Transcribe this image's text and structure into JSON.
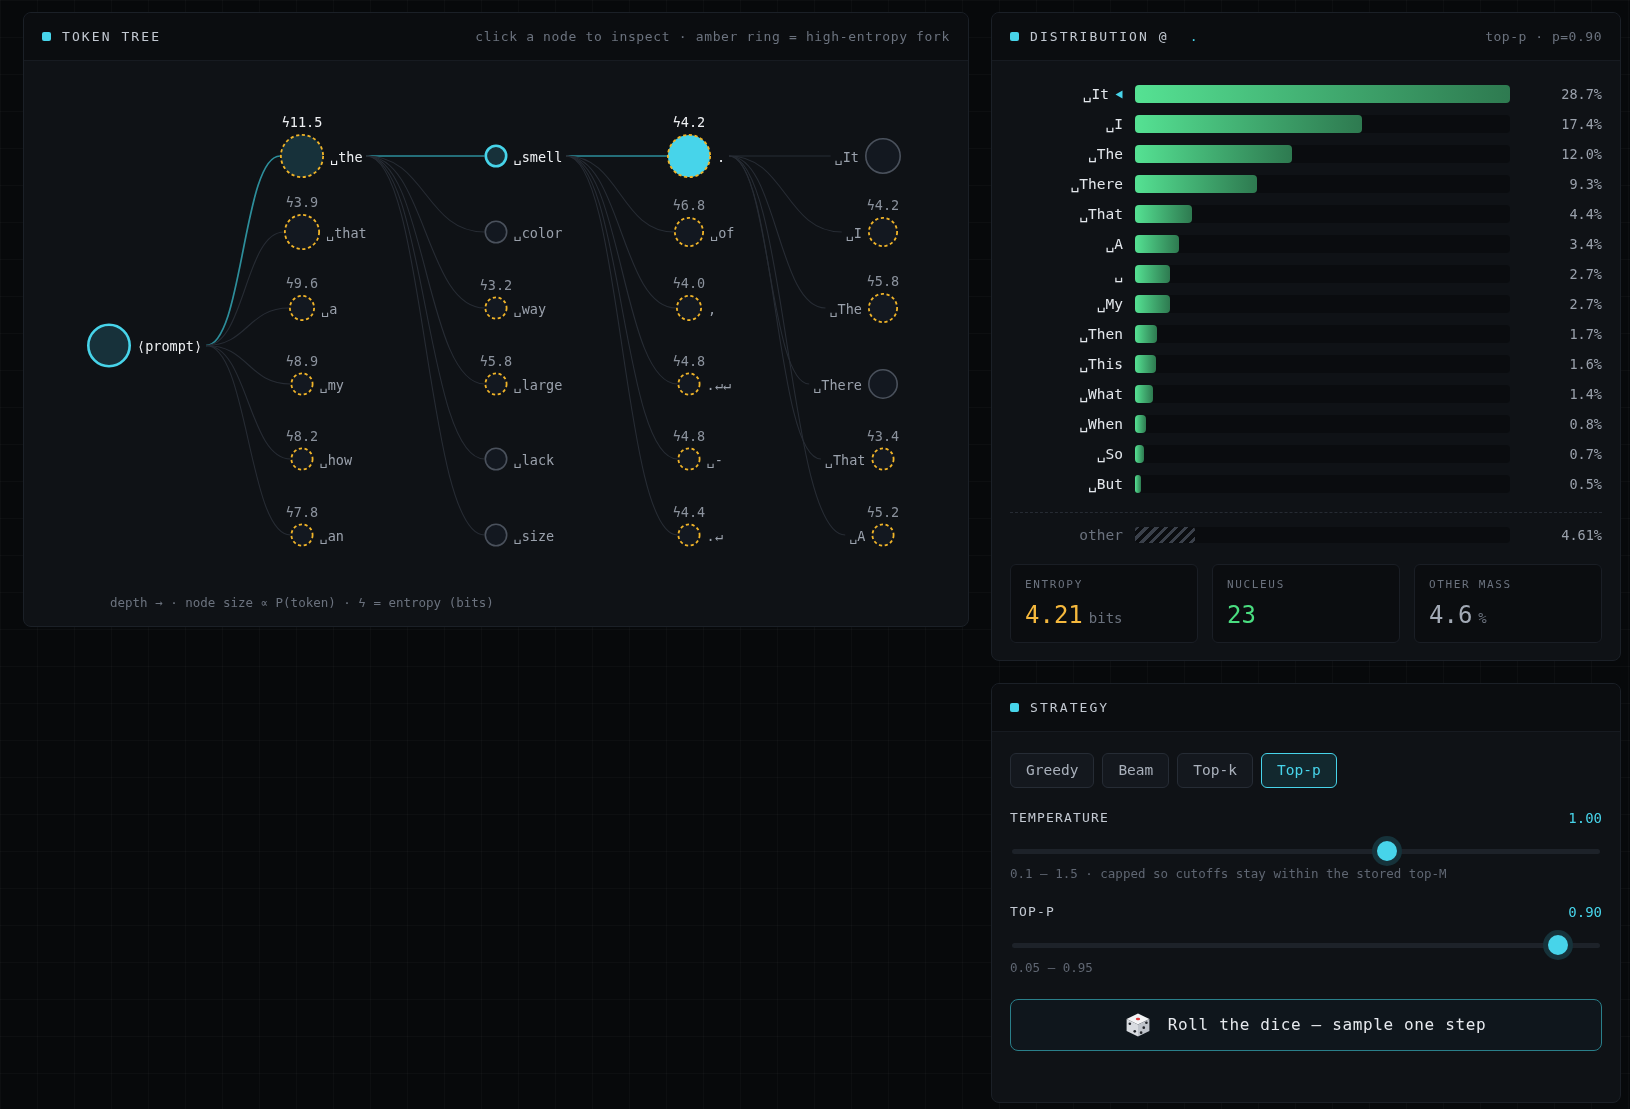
{
  "token_tree": {
    "title": "TOKEN TREE",
    "hint": "click a node to inspect · amber ring = high-entropy fork",
    "root": {
      "token": "⟨prompt⟩",
      "kind": "huge",
      "on_path": true,
      "selected": false,
      "high_entropy": false,
      "children": [
        {
          "token": "␣the",
          "entropy": "ϟ11.5",
          "kind": "huge",
          "on_path": true,
          "selected": false,
          "high_entropy": true,
          "children": [
            {
              "token": "␣smell",
              "kind": "tiny",
              "on_path": true,
              "selected": false,
              "high_entropy": false,
              "children": [
                {
                  "token": ".",
                  "entropy": "ϟ4.2",
                  "kind": "huge",
                  "on_path": true,
                  "selected": true,
                  "high_entropy": true,
                  "children": [
                    {
                      "token": "␣It",
                      "kind": "large",
                      "on_path": false,
                      "selected": false,
                      "high_entropy": false
                    },
                    {
                      "token": "␣I",
                      "entropy": "ϟ4.2",
                      "kind": "medium",
                      "on_path": false,
                      "selected": false,
                      "high_entropy": true
                    },
                    {
                      "token": "␣The",
                      "entropy": "ϟ5.8",
                      "kind": "medium",
                      "on_path": false,
                      "selected": false,
                      "high_entropy": true
                    },
                    {
                      "token": "␣There",
                      "kind": "medium",
                      "on_path": false,
                      "selected": false,
                      "high_entropy": false
                    },
                    {
                      "token": "␣That",
                      "entropy": "ϟ3.4",
                      "kind": "tiny",
                      "on_path": false,
                      "selected": false,
                      "high_entropy": true
                    },
                    {
                      "token": "␣A",
                      "entropy": "ϟ5.2",
                      "kind": "tiny",
                      "on_path": false,
                      "selected": false,
                      "high_entropy": true
                    }
                  ]
                },
                {
                  "token": "␣of",
                  "entropy": "ϟ6.8",
                  "kind": "medium",
                  "on_path": false,
                  "selected": false,
                  "high_entropy": true
                },
                {
                  "token": ",",
                  "entropy": "ϟ4.0",
                  "kind": "small",
                  "on_path": false,
                  "selected": false,
                  "high_entropy": true
                },
                {
                  "token": ".↵↵",
                  "entropy": "ϟ4.8",
                  "kind": "tiny",
                  "on_path": false,
                  "selected": false,
                  "high_entropy": true
                },
                {
                  "token": "␣-",
                  "entropy": "ϟ4.8",
                  "kind": "tiny",
                  "on_path": false,
                  "selected": false,
                  "high_entropy": true
                },
                {
                  "token": ".↵",
                  "entropy": "ϟ4.4",
                  "kind": "tiny",
                  "on_path": false,
                  "selected": false,
                  "high_entropy": true
                }
              ]
            },
            {
              "token": "␣color",
              "kind": "tiny",
              "on_path": false,
              "selected": false,
              "high_entropy": false
            },
            {
              "token": "␣way",
              "entropy": "ϟ3.2",
              "kind": "tiny",
              "on_path": false,
              "selected": false,
              "high_entropy": true
            },
            {
              "token": "␣large",
              "entropy": "ϟ5.8",
              "kind": "tiny",
              "on_path": false,
              "selected": false,
              "high_entropy": true
            },
            {
              "token": "␣lack",
              "kind": "tiny",
              "on_path": false,
              "selected": false,
              "high_entropy": false
            },
            {
              "token": "␣size",
              "kind": "tiny",
              "on_path": false,
              "selected": false,
              "high_entropy": false
            }
          ]
        },
        {
          "token": "␣that",
          "entropy": "ϟ3.9",
          "kind": "large",
          "on_path": false,
          "selected": false,
          "high_entropy": true
        },
        {
          "token": "␣a",
          "entropy": "ϟ9.6",
          "kind": "small",
          "on_path": false,
          "selected": false,
          "high_entropy": true
        },
        {
          "token": "␣my",
          "entropy": "ϟ8.9",
          "kind": "tiny",
          "on_path": false,
          "selected": false,
          "high_entropy": true
        },
        {
          "token": "␣how",
          "entropy": "ϟ8.2",
          "kind": "tiny",
          "on_path": false,
          "selected": false,
          "high_entropy": true
        },
        {
          "token": "␣an",
          "entropy": "ϟ7.8",
          "kind": "tiny",
          "on_path": false,
          "selected": false,
          "high_entropy": true
        }
      ]
    },
    "legend": "depth → · node size ∝ P(token) · ϟ = entropy (bits)"
  },
  "distribution": {
    "title": "DISTRIBUTION @",
    "token": ".",
    "mode": "top-p · p=0.90",
    "rows": [
      {
        "token": "␣It",
        "selected": true,
        "level": 1.0,
        "percent": "28.7%"
      },
      {
        "token": "␣I",
        "selected": false,
        "level": 0.606,
        "percent": "17.4%"
      },
      {
        "token": "␣The",
        "selected": false,
        "level": 0.418,
        "percent": "12.0%"
      },
      {
        "token": "␣There",
        "selected": false,
        "level": 0.324,
        "percent": "9.3%"
      },
      {
        "token": "␣That",
        "selected": false,
        "level": 0.153,
        "percent": "4.4%"
      },
      {
        "token": "␣A",
        "selected": false,
        "level": 0.118,
        "percent": "3.4%"
      },
      {
        "token": "␣",
        "selected": false,
        "level": 0.094,
        "percent": "2.7%"
      },
      {
        "token": "␣My",
        "selected": false,
        "level": 0.094,
        "percent": "2.7%"
      },
      {
        "token": "␣Then",
        "selected": false,
        "level": 0.059,
        "percent": "1.7%"
      },
      {
        "token": "␣This",
        "selected": false,
        "level": 0.056,
        "percent": "1.6%"
      },
      {
        "token": "␣What",
        "selected": false,
        "level": 0.049,
        "percent": "1.4%"
      },
      {
        "token": "␣When",
        "selected": false,
        "level": 0.028,
        "percent": "0.8%"
      },
      {
        "token": "␣So",
        "selected": false,
        "level": 0.024,
        "percent": "0.7%"
      },
      {
        "token": "␣But",
        "selected": false,
        "level": 0.017,
        "percent": "0.5%"
      }
    ],
    "other": {
      "label": "other",
      "level": 0.161,
      "percent": "4.61%"
    },
    "stats": [
      {
        "label": "ENTROPY",
        "value": "4.21",
        "unit": "bits",
        "color": "#f5b83d"
      },
      {
        "label": "NUCLEUS",
        "value": "23",
        "color": "#4ade80"
      },
      {
        "label": "OTHER MASS",
        "value": "4.6",
        "unit": "%",
        "color": "#a3aab6"
      }
    ]
  },
  "strategy": {
    "title": "STRATEGY",
    "tabs": [
      {
        "label": "Greedy",
        "selected": false
      },
      {
        "label": "Beam",
        "selected": false
      },
      {
        "label": "Top-k",
        "selected": false
      },
      {
        "label": "Top-p",
        "selected": true
      }
    ],
    "sliders": [
      {
        "label": "TEMPERATURE",
        "reading": "1.00",
        "level": 0.643,
        "hint": "0.1 – 1.5 · capped so cutoffs stay within the stored top-M"
      },
      {
        "label": "TOP-P",
        "reading": "0.90",
        "level": 0.944,
        "hint": "0.05 – 0.95"
      }
    ],
    "button": {
      "label": "Roll the dice — sample one step"
    }
  }
}
